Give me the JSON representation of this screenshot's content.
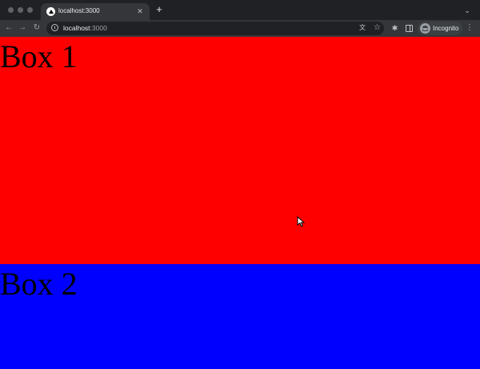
{
  "browser": {
    "tab": {
      "title": "localhost:3000"
    },
    "address_bar": {
      "host": "localhost",
      "port": ":3000"
    },
    "profile_chip": {
      "label": "Incognito"
    },
    "icons": {
      "close_tab": "close-icon",
      "new_tab": "plus-icon",
      "tab_menu": "chevron-down-icon",
      "back": "arrow-left-icon",
      "forward": "arrow-right-icon",
      "reload": "reload-icon",
      "site_info": "info-icon",
      "translate": "translate-icon",
      "bookmark": "star-icon",
      "extensions": "puzzle-icon",
      "side_panel": "side-panel-icon",
      "profile": "incognito-icon",
      "menu": "kebab-menu-icon"
    }
  },
  "page": {
    "boxes": [
      {
        "label": "Box 1",
        "color": "#ff0000"
      },
      {
        "label": "Box 2",
        "color": "#0000ff"
      }
    ]
  }
}
